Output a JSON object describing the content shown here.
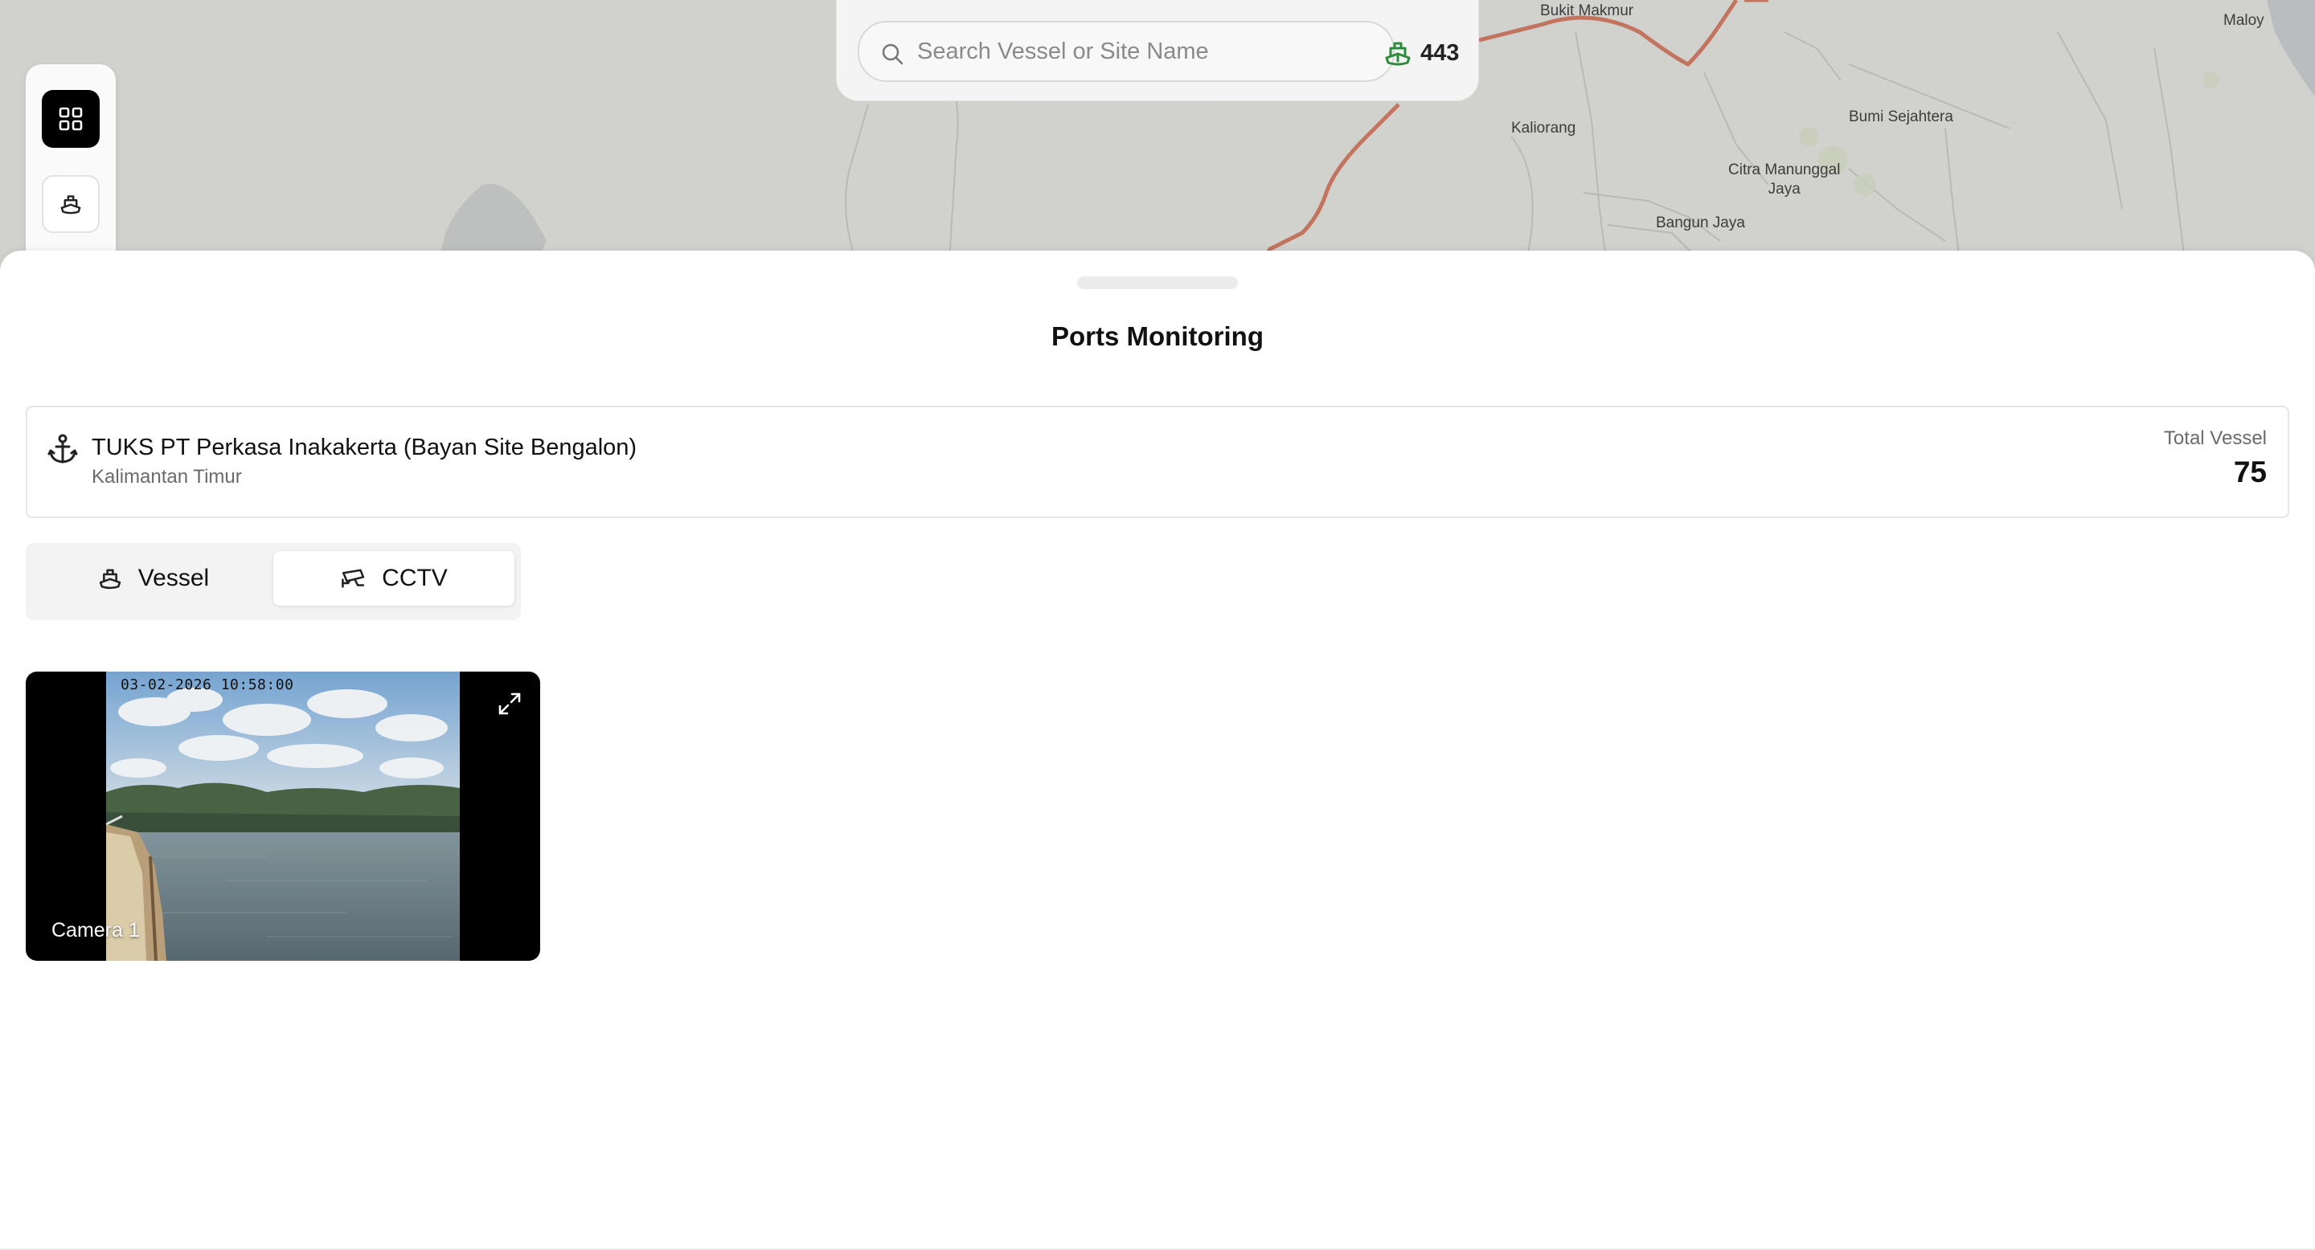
{
  "map": {
    "place_labels": [
      {
        "name": "Bukit Makmur"
      },
      {
        "name": "Maloy"
      },
      {
        "name": "Kaliorang"
      },
      {
        "name": "Bumi Sejahtera"
      },
      {
        "name": "Citra Manunggal\nJaya"
      },
      {
        "name": "Bangun Jaya"
      }
    ],
    "colors": {
      "background": "#e9e9e6",
      "road": "#d9826a",
      "water": "#cfd3d6"
    }
  },
  "search": {
    "placeholder": "Search Vessel or Site Name",
    "value": "",
    "icon": "search-icon",
    "vessel_count": "443",
    "vessel_count_icon": "ship-icon",
    "vessel_count_color": "#2e8b3a"
  },
  "left_rail": {
    "items": [
      {
        "icon": "grid-icon",
        "active": true
      },
      {
        "icon": "ship-icon",
        "active": false
      }
    ]
  },
  "sheet": {
    "title": "Ports Monitoring",
    "site": {
      "icon": "anchor-icon",
      "name": "TUKS PT Perkasa Inakakerta (Bayan Site Bengalon)",
      "region": "Kalimantan Timur",
      "total_vessel_label": "Total Vessel",
      "total_vessel_value": "75"
    },
    "tabs": [
      {
        "label": "Vessel",
        "icon": "ship-icon",
        "selected": false
      },
      {
        "label": "CCTV",
        "icon": "cctv-icon",
        "selected": true
      }
    ],
    "cameras": [
      {
        "label": "Camera 1",
        "timestamp": "03-02-2026 10:58:00",
        "expand_icon": "expand-icon"
      }
    ]
  }
}
